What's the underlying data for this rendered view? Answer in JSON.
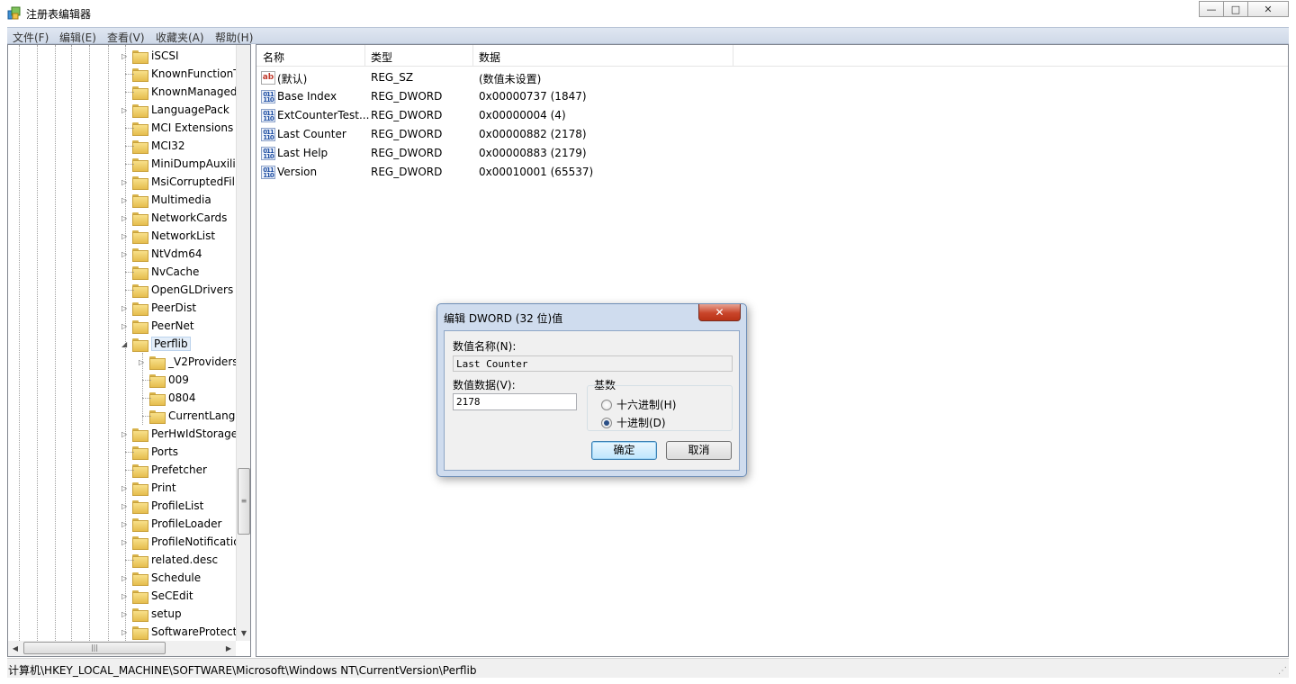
{
  "window": {
    "title": "注册表编辑器",
    "buttons": {
      "minimize": "—",
      "maximize": "□",
      "close": "✕"
    }
  },
  "menu": [
    "文件(F)",
    "编辑(E)",
    "查看(V)",
    "收藏夹(A)",
    "帮助(H)"
  ],
  "tree": {
    "items": [
      {
        "label": "iSCSI",
        "expandable": true
      },
      {
        "label": "KnownFunctionT",
        "expandable": false
      },
      {
        "label": "KnownManaged",
        "expandable": false
      },
      {
        "label": "LanguagePack",
        "expandable": true
      },
      {
        "label": "MCI Extensions",
        "expandable": false
      },
      {
        "label": "MCI32",
        "expandable": false
      },
      {
        "label": "MiniDumpAuxilia",
        "expandable": false
      },
      {
        "label": "MsiCorruptedFil",
        "expandable": true
      },
      {
        "label": "Multimedia",
        "expandable": true
      },
      {
        "label": "NetworkCards",
        "expandable": true
      },
      {
        "label": "NetworkList",
        "expandable": true
      },
      {
        "label": "NtVdm64",
        "expandable": true
      },
      {
        "label": "NvCache",
        "expandable": false
      },
      {
        "label": "OpenGLDrivers",
        "expandable": false
      },
      {
        "label": "PeerDist",
        "expandable": true
      },
      {
        "label": "PeerNet",
        "expandable": true
      },
      {
        "label": "Perflib",
        "expandable": true,
        "expanded": true,
        "selected": true
      },
      {
        "label": "_V2Providers",
        "expandable": true,
        "child": true
      },
      {
        "label": "009",
        "expandable": false,
        "child": true
      },
      {
        "label": "0804",
        "expandable": false,
        "child": true
      },
      {
        "label": "CurrentLangu",
        "expandable": false,
        "child": true
      },
      {
        "label": "PerHwIdStorage",
        "expandable": true
      },
      {
        "label": "Ports",
        "expandable": false
      },
      {
        "label": "Prefetcher",
        "expandable": false
      },
      {
        "label": "Print",
        "expandable": true
      },
      {
        "label": "ProfileList",
        "expandable": true
      },
      {
        "label": "ProfileLoader",
        "expandable": true
      },
      {
        "label": "ProfileNotificatio",
        "expandable": true
      },
      {
        "label": "related.desc",
        "expandable": false
      },
      {
        "label": "Schedule",
        "expandable": true
      },
      {
        "label": "SeCEdit",
        "expandable": true
      },
      {
        "label": "setup",
        "expandable": true
      },
      {
        "label": "SoftwareProtecti",
        "expandable": true
      }
    ]
  },
  "list": {
    "columns": [
      "名称",
      "类型",
      "数据"
    ],
    "rows": [
      {
        "icon": "string-value-icon",
        "name": "(默认)",
        "type": "REG_SZ",
        "data": "(数值未设置)"
      },
      {
        "icon": "binary-value-icon",
        "name": "Base Index",
        "type": "REG_DWORD",
        "data": "0x00000737 (1847)"
      },
      {
        "icon": "binary-value-icon",
        "name": "ExtCounterTest...",
        "type": "REG_DWORD",
        "data": "0x00000004 (4)"
      },
      {
        "icon": "binary-value-icon",
        "name": "Last Counter",
        "type": "REG_DWORD",
        "data": "0x00000882 (2178)"
      },
      {
        "icon": "binary-value-icon",
        "name": "Last Help",
        "type": "REG_DWORD",
        "data": "0x00000883 (2179)"
      },
      {
        "icon": "binary-value-icon",
        "name": "Version",
        "type": "REG_DWORD",
        "data": "0x00010001 (65537)"
      }
    ]
  },
  "statusbar": {
    "path": "计算机\\HKEY_LOCAL_MACHINE\\SOFTWARE\\Microsoft\\Windows NT\\CurrentVersion\\Perflib"
  },
  "dialog": {
    "title": "编辑 DWORD (32 位)值",
    "close": "✕",
    "name_label": "数值名称(N):",
    "name_value": "Last Counter",
    "data_label": "数值数据(V):",
    "data_value": "2178",
    "base_label": "基数",
    "radio_hex": "十六进制(H)",
    "radio_dec": "十进制(D)",
    "selected_base": "decimal",
    "ok": "确定",
    "cancel": "取消"
  },
  "colors": {
    "menubar": "#dfe6f1",
    "dialog_frame": "#cfdcee",
    "close_red": "#c9452a"
  }
}
